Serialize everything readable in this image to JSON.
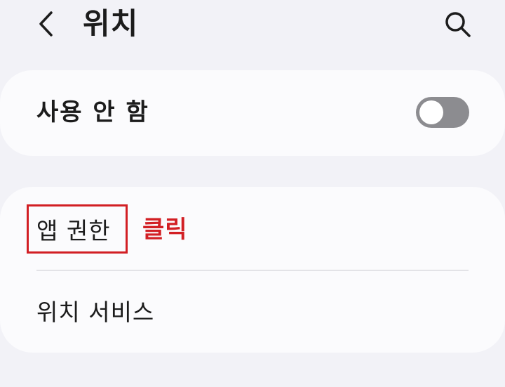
{
  "header": {
    "title": "위치"
  },
  "location_toggle": {
    "label": "사용 안 함",
    "state": "off"
  },
  "menu": {
    "items": [
      {
        "label": "앱 권한"
      },
      {
        "label": "위치 서비스"
      }
    ]
  },
  "annotation": {
    "text": "클릭",
    "color": "#d21f24"
  },
  "icons": {
    "back": "chevron-left-icon",
    "search": "search-icon"
  },
  "colors": {
    "background": "#f2f2f7",
    "card": "#fbfbfd",
    "toggle_off": "#8c8c90"
  }
}
